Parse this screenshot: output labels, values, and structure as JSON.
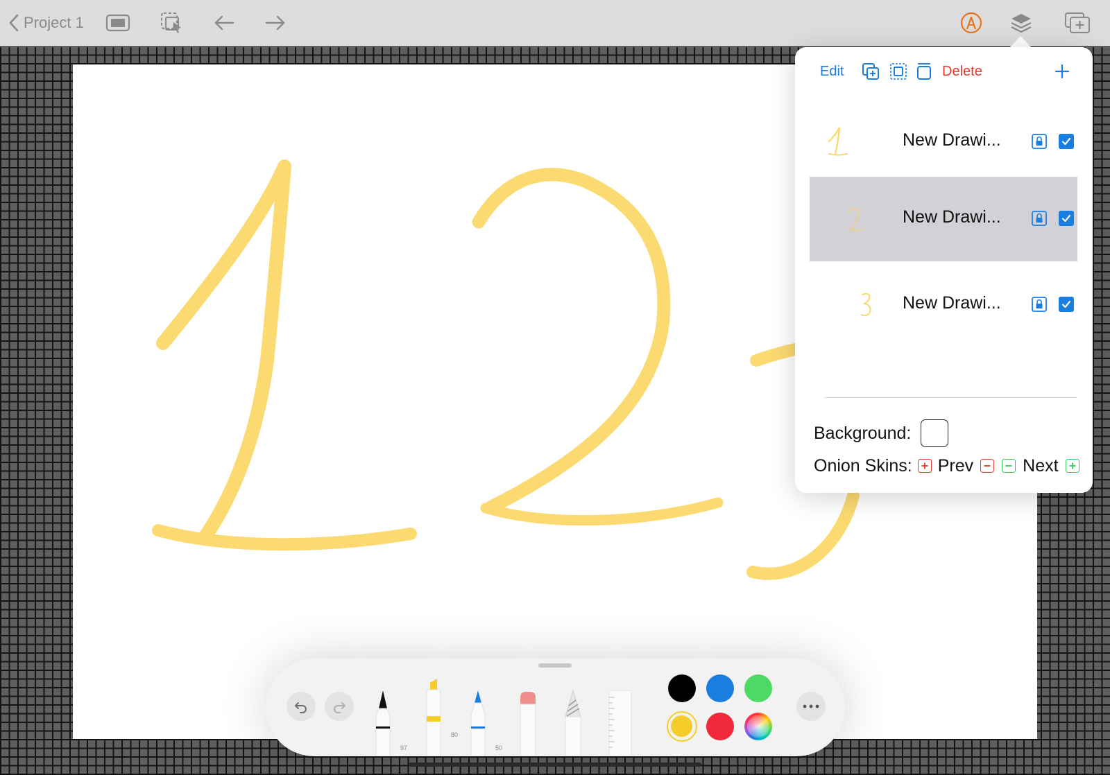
{
  "topbar": {
    "back_label": "Project 1",
    "icons": [
      "chevron-left-icon",
      "presentation-icon",
      "select-icon",
      "arrow-left-icon",
      "arrow-right-icon",
      "pencil-circle-icon",
      "layers-icon",
      "add-frame-icon"
    ]
  },
  "layers_popover": {
    "edit_label": "Edit",
    "delete_label": "Delete",
    "layers": [
      {
        "name": "New Drawi...",
        "thumb_glyph": "1",
        "selected": false,
        "visible": true
      },
      {
        "name": "New Drawi...",
        "thumb_glyph": "2",
        "selected": true,
        "visible": true
      },
      {
        "name": "New Drawi...",
        "thumb_glyph": "3",
        "selected": false,
        "visible": true
      }
    ],
    "background_label": "Background:",
    "onion_label": "Onion Skins:",
    "prev_label": "Prev",
    "next_label": "Next"
  },
  "palette": {
    "tools": [
      {
        "name": "pen",
        "number": "97"
      },
      {
        "name": "marker",
        "number": "80"
      },
      {
        "name": "pencil",
        "number": "50"
      },
      {
        "name": "eraser",
        "number": ""
      },
      {
        "name": "lasso",
        "number": ""
      },
      {
        "name": "ruler",
        "number": ""
      }
    ],
    "colors": [
      "#000000",
      "#1a7de0",
      "#4cd964",
      "#f5cd2a",
      "#f0283c",
      "spectrum"
    ],
    "selected_color": "#f5cd2a"
  },
  "colors": {
    "accent": "#1a7de0",
    "destructive": "#e8382b",
    "stroke": "#fcd86a"
  }
}
